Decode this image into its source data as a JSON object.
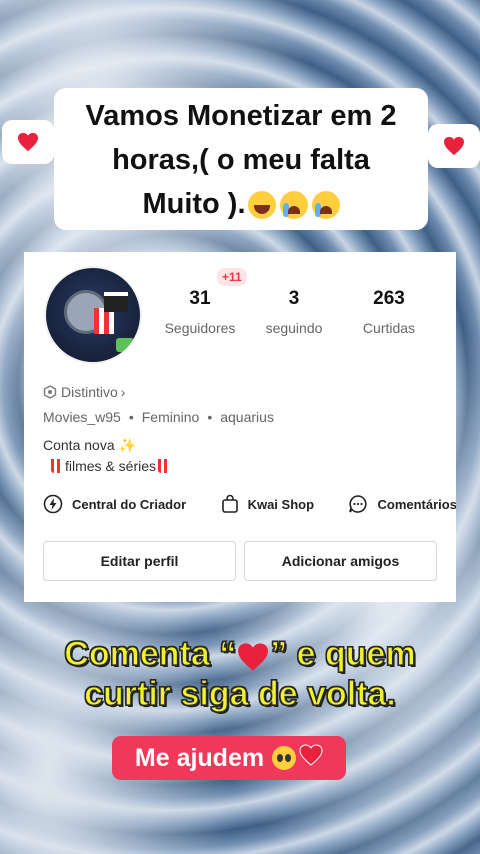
{
  "caption": {
    "line1": "Vamos Monetizar em 2",
    "line2": "horas,( o meu falta",
    "line3": "Muito )."
  },
  "profile": {
    "badge_new_followers": "+11",
    "stats": [
      {
        "value": "31",
        "label": "Seguidores"
      },
      {
        "value": "3",
        "label": "seguindo"
      },
      {
        "value": "263",
        "label": "Curtidas"
      }
    ],
    "distintivo": "Distintivo",
    "username": "Movies_w95",
    "gender": "Feminino",
    "sign": "aquarius",
    "bio_line1": "Conta nova ✨",
    "bio_line2": "filmes & séries",
    "shortcuts": [
      "Central do Criador",
      "Kwai Shop",
      "Comentários"
    ],
    "buttons": {
      "edit": "Editar perfil",
      "add_friends": "Adicionar amigos"
    }
  },
  "cta": {
    "line1_a": "Comenta “",
    "line1_b": "” e quem",
    "line2": "curtir siga de volta."
  },
  "help_label": "Me ajudem",
  "colors": {
    "heart": "#e8223c",
    "cta_text": "#f0f22d",
    "help_bg": "#f0395a",
    "badge": "#e8334a"
  }
}
